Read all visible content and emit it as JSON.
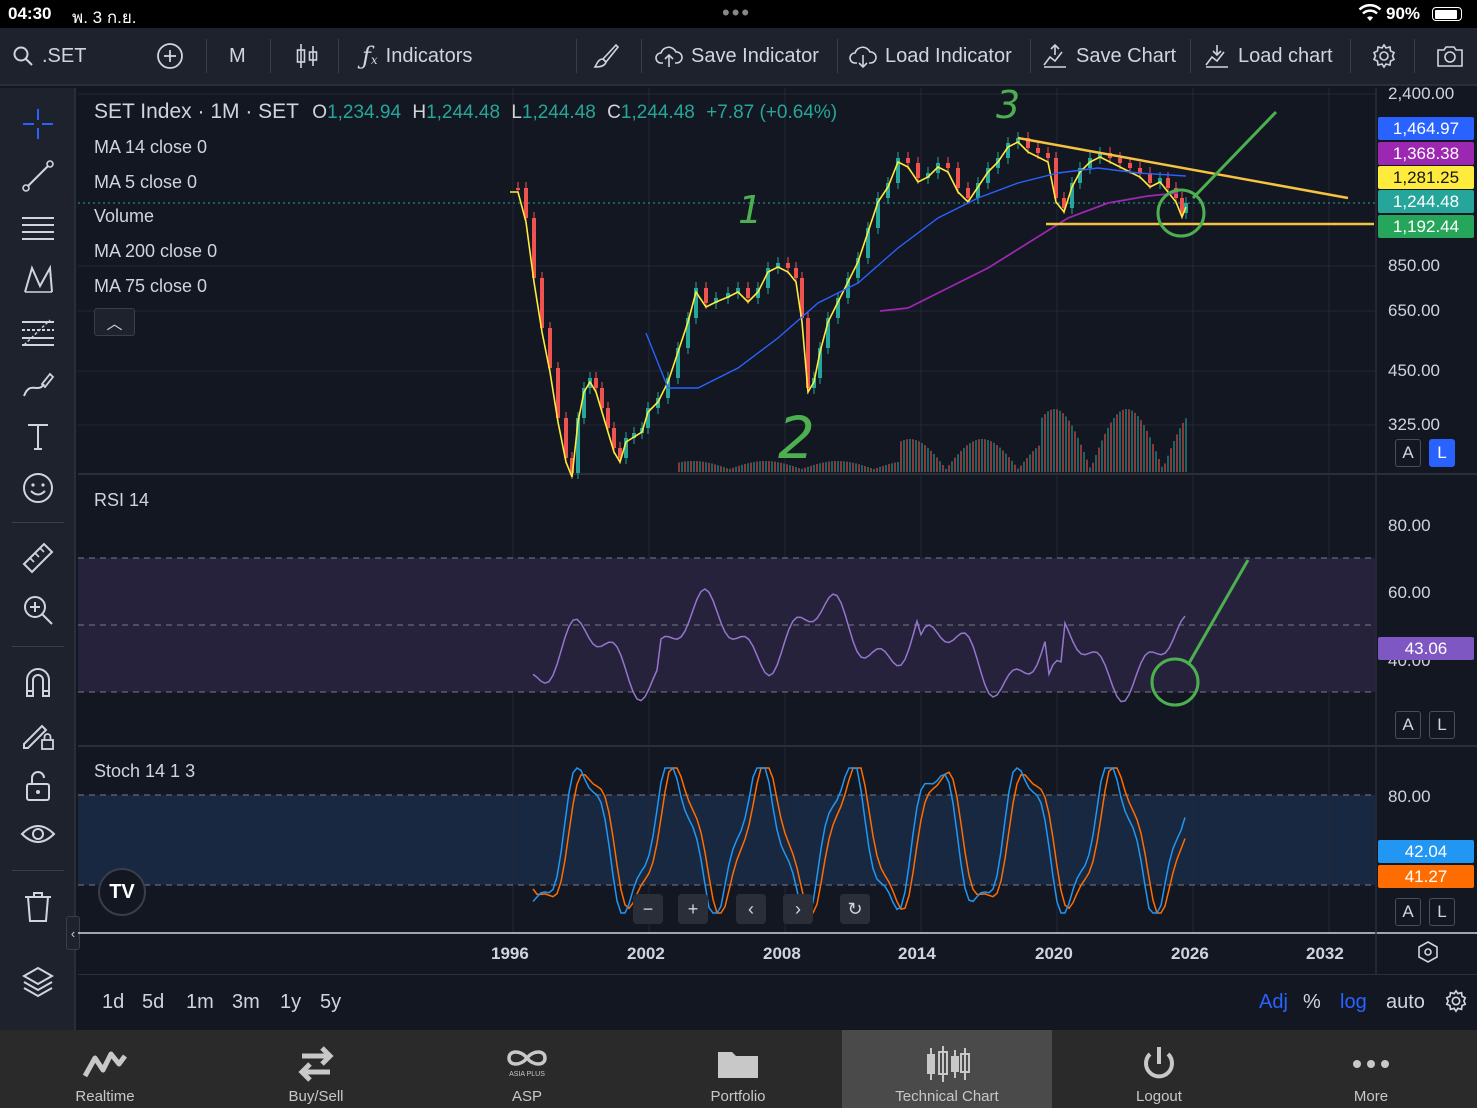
{
  "status": {
    "time": "04:30",
    "date": "พ. 3 ก.ย.",
    "battery": "90%"
  },
  "toolbar": {
    "symbol": ".SET",
    "interval": "M",
    "indicators": "Indicators",
    "save_indicator": "Save Indicator",
    "load_indicator": "Load Indicator",
    "save_chart": "Save Chart",
    "load_chart": "Load chart"
  },
  "legend": {
    "title": "SET Index · 1M · SET",
    "o_label": "O",
    "o": "1,234.94",
    "h_label": "H",
    "h": "1,244.48",
    "l_label": "L",
    "l": "1,244.48",
    "c_label": "C",
    "c": "1,244.48",
    "change": "+7.87 (+0.64%)"
  },
  "indicators": [
    "MA 14 close 0",
    "MA 5 close 0",
    "Volume",
    "MA 200 close 0",
    "MA 75 close 0"
  ],
  "panes": {
    "rsi": "RSI 14",
    "stoch": "Stoch 14 1 3"
  },
  "price_axis": {
    "ticks": [
      "2,400.00",
      "850.00",
      "650.00",
      "450.00",
      "325.00"
    ],
    "tags": [
      {
        "value": "1,464.97",
        "color": "#2962ff"
      },
      {
        "value": "1,368.38",
        "color": "#9c27b0"
      },
      {
        "value": "1,281.25",
        "color": "#ffeb3b"
      },
      {
        "value": "1,244.48",
        "color": "#26a69a"
      },
      {
        "value": "1,192.44",
        "color": "#26a65b"
      }
    ]
  },
  "rsi_axis": {
    "ticks": [
      "80.00",
      "60.00",
      "40.00"
    ],
    "current": "43.06"
  },
  "stoch_axis": {
    "ticks": [
      "80.00"
    ],
    "k": "42.04",
    "d": "41.27"
  },
  "scale_buttons": {
    "a": "A",
    "l": "L"
  },
  "x_axis": [
    "1996",
    "2002",
    "2008",
    "2014",
    "2020",
    "2026",
    "2032"
  ],
  "annotations": {
    "one": "1",
    "two": "2",
    "three": "3"
  },
  "ranges": [
    "1d",
    "5d",
    "1m",
    "3m",
    "1y",
    "5y"
  ],
  "scale_opts": {
    "adj": "Adj",
    "pct": "%",
    "log": "log",
    "auto": "auto"
  },
  "logo": "TV",
  "bottom_nav": [
    {
      "label": "Realtime"
    },
    {
      "label": "Buy/Sell"
    },
    {
      "label": "ASP",
      "sub": "ASIA PLUS"
    },
    {
      "label": "Portfolio"
    },
    {
      "label": "Technical Chart",
      "active": true
    },
    {
      "label": "Logout"
    },
    {
      "label": "More"
    }
  ],
  "colors": {
    "bg": "#131722",
    "up": "#26a69a",
    "down": "#ef5350",
    "ma14": "#ffeb3b",
    "ma5": "#ffeb3b",
    "ma200": "#9c27b0",
    "ma75": "#2962ff",
    "rsi": "#9575cd",
    "stoch_k": "#2196f3",
    "stoch_d": "#ff6d00",
    "annotation": "#4caf50",
    "trendline": "#f5c242"
  }
}
